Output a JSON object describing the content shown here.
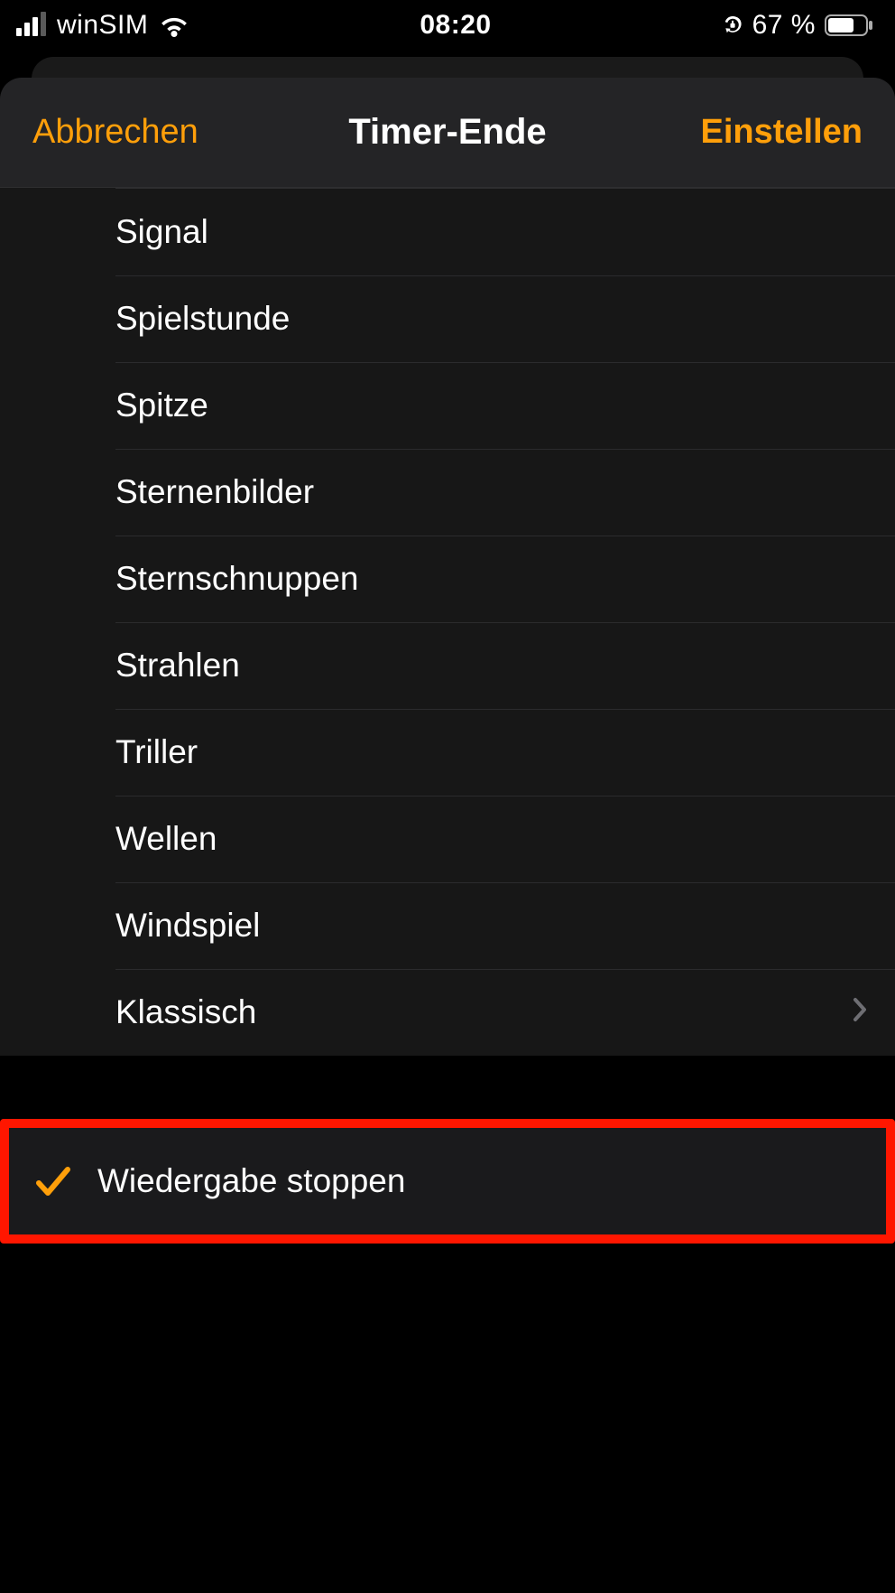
{
  "status": {
    "carrier": "winSIM",
    "time": "08:20",
    "battery_text": "67 %",
    "battery_pct": 67
  },
  "colors": {
    "accent": "#ff9f0a",
    "highlight_border": "#ff1600"
  },
  "nav": {
    "cancel": "Abbrechen",
    "title": "Timer-Ende",
    "set": "Einstellen"
  },
  "sounds": [
    {
      "label": "Signal",
      "selected": false,
      "disclosure": false
    },
    {
      "label": "Spielstunde",
      "selected": false,
      "disclosure": false
    },
    {
      "label": "Spitze",
      "selected": false,
      "disclosure": false
    },
    {
      "label": "Sternenbilder",
      "selected": false,
      "disclosure": false
    },
    {
      "label": "Sternschnuppen",
      "selected": false,
      "disclosure": false
    },
    {
      "label": "Strahlen",
      "selected": false,
      "disclosure": false
    },
    {
      "label": "Triller",
      "selected": false,
      "disclosure": false
    },
    {
      "label": "Wellen",
      "selected": false,
      "disclosure": false
    },
    {
      "label": "Windspiel",
      "selected": false,
      "disclosure": false
    },
    {
      "label": "Klassisch",
      "selected": false,
      "disclosure": true
    }
  ],
  "stop_playback": {
    "label": "Wiedergabe stoppen",
    "selected": true
  }
}
